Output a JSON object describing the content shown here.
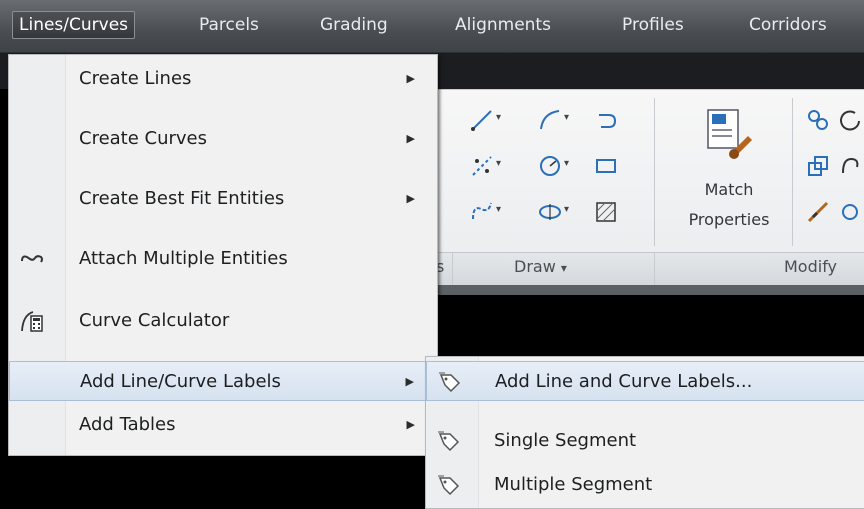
{
  "menubar": {
    "items": [
      {
        "label": "Lines/Curves",
        "active": true
      },
      {
        "label": "Parcels"
      },
      {
        "label": "Grading"
      },
      {
        "label": "Alignments"
      },
      {
        "label": "Profiles"
      },
      {
        "label": "Corridors"
      }
    ]
  },
  "menu": {
    "items": [
      {
        "label": "Create Lines",
        "submenu": true
      },
      {
        "label": "Create Curves",
        "submenu": true
      },
      {
        "label": "Create Best Fit Entities",
        "submenu": true
      },
      {
        "label": "Attach Multiple Entities",
        "icon": "attach-icon"
      },
      {
        "label": "Curve Calculator",
        "icon": "calculator-icon"
      },
      {
        "label": "Add Line/Curve Labels",
        "submenu": true,
        "highlighted": true
      },
      {
        "label": "Add Tables",
        "submenu": true
      }
    ],
    "arrow": "▶"
  },
  "submenu": {
    "items": [
      {
        "label": "Add Line and Curve Labels...",
        "icon": "label-tag-icon",
        "highlighted": true
      },
      {
        "label": "Single Segment",
        "icon": "label-tag-icon"
      },
      {
        "label": "Multiple Segment",
        "icon": "label-tag-icon"
      }
    ]
  },
  "ribbon": {
    "draw_label": "Draw",
    "modify_label": "Modify",
    "partial_label": "s",
    "match_line1": "Match",
    "match_line2": "Properties",
    "dropdown_glyph": "▾"
  },
  "colors": {
    "menu_bg": "#f1f1f1",
    "highlight": "#d6e2f0",
    "menubar": "#4a4e53"
  }
}
